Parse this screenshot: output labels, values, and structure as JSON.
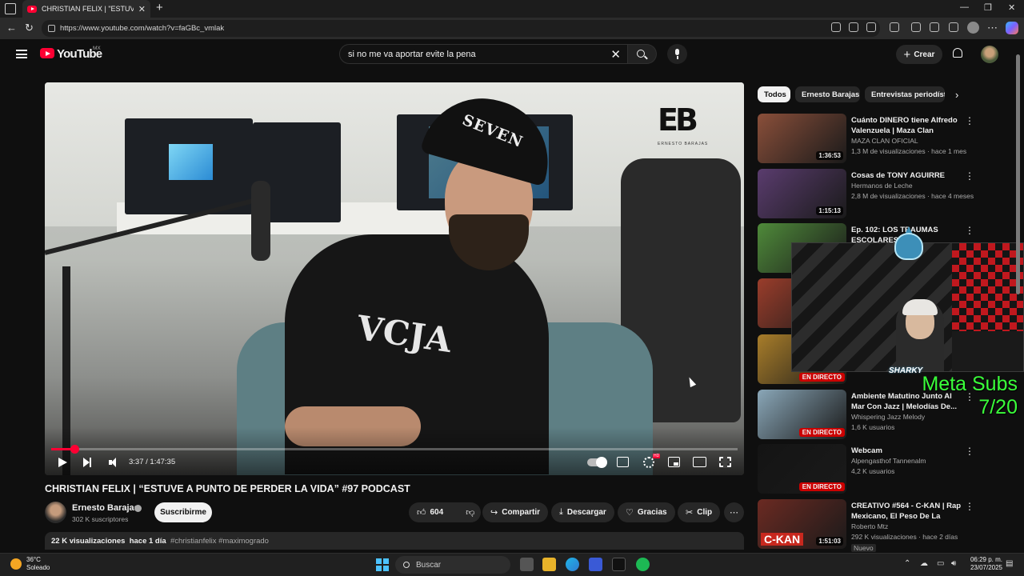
{
  "browser": {
    "tab_title": "CHRISTIAN FELIX | \"ESTUVE A PUNTO",
    "url": "https://www.youtube.com/watch?v=faGBc_vmlak"
  },
  "header": {
    "logo_text": "YouTube",
    "region": "MX",
    "search_value": "si no me va aportar evite la pena",
    "create_label": "Crear"
  },
  "player": {
    "time": "3:37 / 1:47:35",
    "progress_fraction": 0.034,
    "autoplay": true,
    "hd_badge": "HD",
    "brand_logo": "EB",
    "brand_sub": "ERNESTO BARAJAS",
    "cap_text": "SEVEN",
    "shirt_text": "VCJA"
  },
  "video": {
    "title": "CHRISTIAN FELIX | “ESTUVE A PUNTO DE PERDER LA VIDA” #97 PODCAST",
    "channel": "Ernesto Barajas",
    "subscribers": "302 K suscriptores",
    "subscribe_label": "Suscribirme",
    "likes": "604",
    "share_label": "Compartir",
    "download_label": "Descargar",
    "thanks_label": "Gracias",
    "clip_label": "Clip",
    "views": "22 K visualizaciones",
    "age": "hace 1 día",
    "tags": "#christianfelix #maximogrado"
  },
  "chips": [
    {
      "label": "Todos"
    },
    {
      "label": "Ernesto Barajas"
    },
    {
      "label": "Entrevistas periodísticas"
    }
  ],
  "recommendations": [
    {
      "title": "Cuánto DINERO tiene Alfredo Valenzuela | Maza Clan",
      "channel": "MAZA CLAN OFICIAL",
      "meta": "1,3 M de visualizaciones · hace 1 mes",
      "duration": "1:36:53",
      "live": "",
      "thumb": "#8a4f3a"
    },
    {
      "title": "Cosas de TONY AGUIRRE",
      "channel": "Hermanos de Leche",
      "meta": "2,8 M de visualizaciones · hace 4 meses",
      "duration": "1:15:13",
      "live": "",
      "thumb": "#5a3c6e"
    },
    {
      "title": "Ep. 102: LOS TRAUMAS ESCOLARES",
      "channel": "",
      "meta": "",
      "duration": "",
      "live": "",
      "thumb": "#4f8a3a"
    },
    {
      "title": "",
      "channel": "",
      "meta": "",
      "duration": "",
      "live": "",
      "thumb": "#9a3d2b"
    },
    {
      "title": "",
      "channel": "",
      "meta": "",
      "duration": "",
      "live": "EN DIRECTO",
      "thumb": "#a87d2a"
    },
    {
      "title": "Ambiente Matutino Junto Al Mar Con Jazz | Melodías De...",
      "channel": "Whispering Jazz Melody",
      "meta": "1,6 K usuarios",
      "duration": "",
      "live": "EN DIRECTO",
      "thumb": "#8aa7b8"
    },
    {
      "title": "Webcam",
      "channel": "Alpengasthof Tannenalm",
      "meta": "4,2 K usuarios",
      "duration": "",
      "live": "EN DIRECTO",
      "thumb": "#141414"
    },
    {
      "title": "CREATIVO #564 - C-KAN | Rap Mexicano, El Peso De La Calle,...",
      "channel": "Roberto Mtz",
      "meta": "292 K visualizaciones · hace 2 días",
      "duration": "1:51:03",
      "live": "",
      "thumb": "#6b2a22",
      "badge": "C-KAN",
      "tag": "Nuevo"
    }
  ],
  "overlay": {
    "shark_label": "SHARKY",
    "goal_line1": "Meta Subs",
    "goal_line2": "7/20"
  },
  "taskbar": {
    "temperature": "36°C",
    "weather": "Soleado",
    "search_label": "Buscar",
    "time": "06:29 p. m.",
    "date": "23/07/2025"
  }
}
